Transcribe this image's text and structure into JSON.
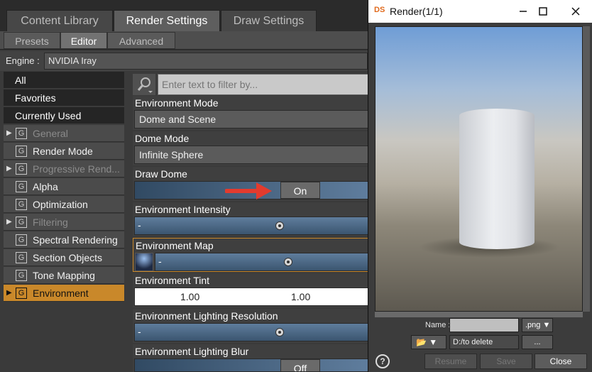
{
  "top_tabs": [
    "Content Library",
    "Render Settings",
    "Draw Settings"
  ],
  "sub_tabs": [
    "Presets",
    "Editor",
    "Advanced"
  ],
  "engine": {
    "label": "Engine :",
    "value": "NVIDIA Iray"
  },
  "left_list": {
    "top_items": [
      "All",
      "Favorites",
      "Currently Used"
    ],
    "groups": [
      {
        "label": "General",
        "expandable": true,
        "dim": true
      },
      {
        "label": "Render Mode",
        "expandable": false,
        "dim": false
      },
      {
        "label": "Progressive Rend...",
        "expandable": true,
        "dim": true
      },
      {
        "label": "Alpha",
        "expandable": false,
        "dim": false
      },
      {
        "label": "Optimization",
        "expandable": false,
        "dim": false
      },
      {
        "label": "Filtering",
        "expandable": true,
        "dim": true
      },
      {
        "label": "Spectral Rendering",
        "expandable": false,
        "dim": false
      },
      {
        "label": "Section Objects",
        "expandable": false,
        "dim": false
      },
      {
        "label": "Tone Mapping",
        "expandable": false,
        "dim": false
      },
      {
        "label": "Environment",
        "expandable": true,
        "dim": false,
        "selected": true
      }
    ],
    "group_icon_glyph": "G",
    "expand_glyph": "▶"
  },
  "filter": {
    "placeholder": "Enter text to filter by..."
  },
  "properties": {
    "env_mode": {
      "label": "Environment Mode",
      "value": "Dome and Scene"
    },
    "dome_mode": {
      "label": "Dome Mode",
      "value": "Infinite Sphere"
    },
    "draw_dome": {
      "label": "Draw Dome",
      "value": "On"
    },
    "env_intensity": {
      "label": "Environment Intensity",
      "minus": "-",
      "level": 0.62
    },
    "env_map": {
      "label": "Environment Map",
      "minus": "-",
      "level": 0.62
    },
    "env_tint": {
      "label": "Environment Tint",
      "v1": "1.00",
      "v2": "1.00"
    },
    "env_light_res": {
      "label": "Environment Lighting Resolution",
      "minus": "-",
      "level": 0.62
    },
    "env_light_blur": {
      "label": "Environment Lighting Blur",
      "value": "Off"
    }
  },
  "render_window": {
    "logo": "DS",
    "title": "Render(1/1)",
    "name_label": "Name :",
    "name_value": "",
    "ext": ".png ▼",
    "folder": "📂 ▼",
    "path": "D:/to delete",
    "browse": "...",
    "help": "?",
    "buttons": {
      "resume": "Resume",
      "save": "Save",
      "close": "Close"
    }
  },
  "colors": {
    "accent": "#c9882a",
    "slider": "#4d6986"
  }
}
